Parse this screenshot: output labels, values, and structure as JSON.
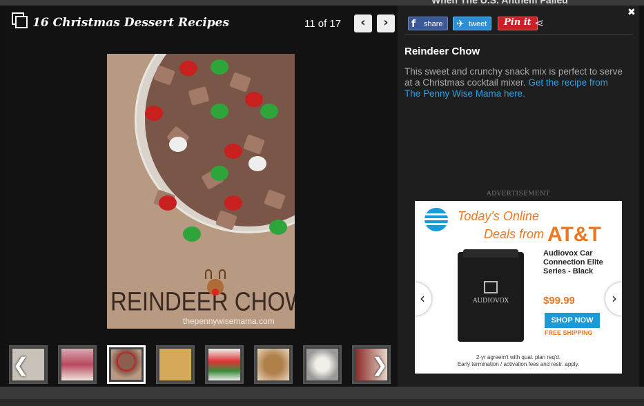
{
  "background_text": "When The U.S. Anthem Failed",
  "gallery": {
    "title": "16 Christmas Dessert Recipes",
    "counter": "11 of 17",
    "prev_icon": "‹",
    "next_icon": "›",
    "photo": {
      "overlay_text": "REINDEER CHOW",
      "site": "thepennywisemama.com"
    },
    "thumb_prev": "❮",
    "thumb_next": "❯"
  },
  "sidebar": {
    "share_facebook": "share",
    "share_twitter": "tweet",
    "share_pinterest": "Pin it",
    "close_icon": "✖",
    "item_title": "Reindeer Chow",
    "item_desc": "This sweet and crunchy snack mix is perfect to serve at a Christmas cocktail mixer.",
    "item_link": "Get the recipe from The Penny Wise Mama here."
  },
  "ad": {
    "label": "ADVERTISEMENT",
    "headline_1": "Today's Online",
    "headline_2": "Deals from",
    "brand": "AT&T",
    "product": "Audiovox Car Connection Elite Series - Black",
    "price": "$99.99",
    "cta": "SHOP NOW",
    "shipping": "FREE SHIPPING",
    "fine_print_1": "2-yr agreem't with qual. plan req'd.",
    "fine_print_2": "Early termination / activation fees and restr. apply.",
    "device_logo": "AUDIOVOX"
  },
  "colors": {
    "accent_link": "#2aa0e6",
    "att_orange": "#f0771f",
    "att_blue": "#1a9ad6"
  }
}
